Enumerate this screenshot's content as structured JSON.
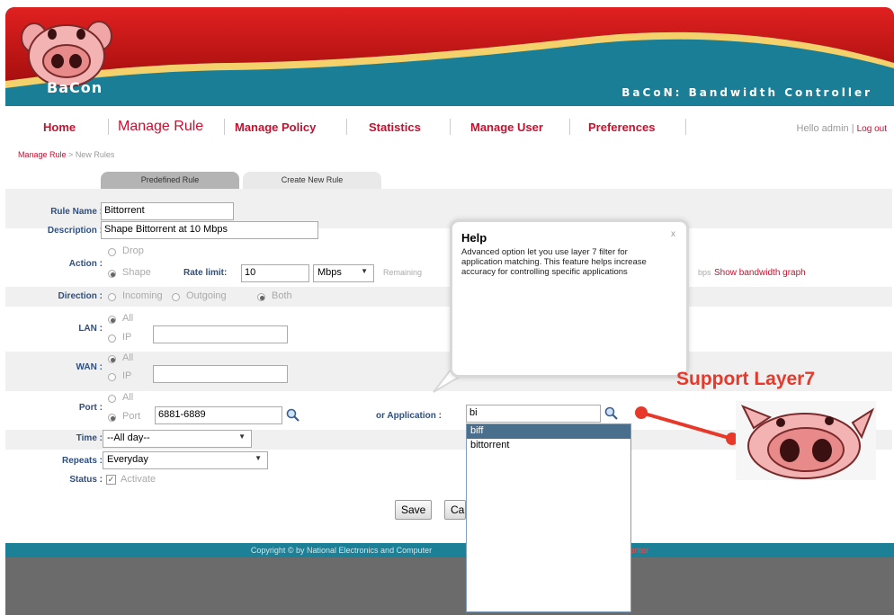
{
  "app": {
    "logo_text": "BaCon",
    "subtitle": "BaCoN: Bandwidth Controller"
  },
  "nav": {
    "home": "Home",
    "manage_rule": "Manage Rule",
    "manage_policy": "Manage Policy",
    "statistics": "Statistics",
    "manage_user": "Manage User",
    "preferences": "Preferences",
    "greeting": "Hello admin",
    "logout": "Log out"
  },
  "breadcrumb": {
    "parent": "Manage Rule",
    "separator": " > ",
    "current": "New Rules"
  },
  "tabs": {
    "predefined": "Predefined Rule",
    "create": "Create New Rule"
  },
  "form": {
    "rule_name_label": "Rule Name :",
    "rule_name_value": "Bittorrent",
    "description_label": "Description :",
    "description_value": "Shape Bittorrent at 10 Mbps",
    "action_label": "Action :",
    "action_drop": "Drop",
    "action_shape": "Shape",
    "rate_limit_label": "Rate limit:",
    "rate_limit_value": "10",
    "rate_unit": "Mbps",
    "remaining_label": "Remaining",
    "remaining_suffix": "bps",
    "show_graph": "Show bandwidth graph",
    "direction_label": "Direction :",
    "dir_incoming": "Incoming",
    "dir_outgoing": "Outgoing",
    "dir_both": "Both",
    "lan_label": "LAN :",
    "lan_all": "All",
    "lan_ip": "IP",
    "wan_label": "WAN :",
    "wan_all": "All",
    "wan_ip": "IP",
    "port_label": "Port :",
    "port_all": "All",
    "port_port": "Port",
    "port_value": "6881-6889",
    "application_label": "or Application :",
    "application_value": "bi",
    "time_label": "Time :",
    "time_value": "--All day--",
    "repeats_label": "Repeats :",
    "repeats_value": "Everyday",
    "status_label": "Status :",
    "status_value": "Activate",
    "save": "Save",
    "cancel": "Ca"
  },
  "help": {
    "title": "Help",
    "close": "x",
    "body": "Advanced option let you use layer 7 filter for application matching. This feature helps increase accuracy for controlling specific applications"
  },
  "autocomplete": {
    "items": [
      "biff",
      "bittorrent"
    ],
    "highlighted": 0
  },
  "annotation": {
    "support": "Support Layer7"
  },
  "footer": {
    "copyright": "Copyright © by National Electronics and Computer",
    "tail": "ology Center"
  },
  "colors": {
    "brand_red": "#c8102e",
    "header_teal": "#1c8196",
    "label_blue": "#2f4f7f",
    "annotation_red": "#e8382a"
  }
}
